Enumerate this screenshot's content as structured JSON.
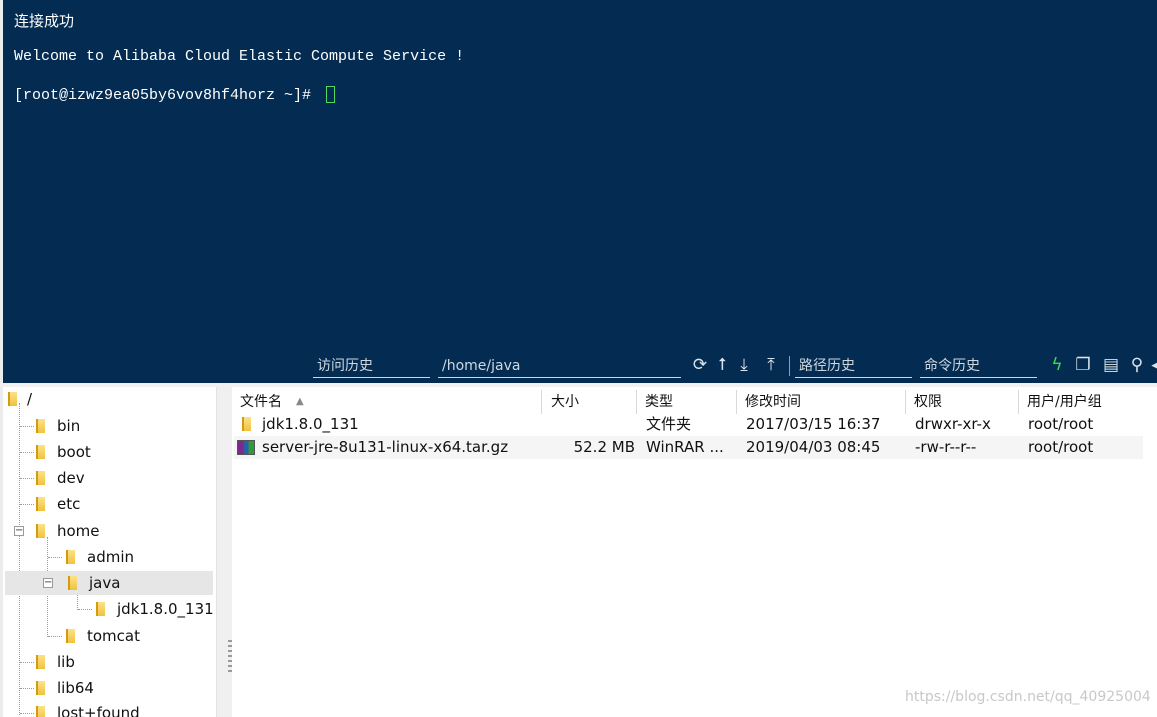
{
  "terminal": {
    "line1": "连接成功",
    "line2": "Welcome to Alibaba Cloud Elastic Compute Service !",
    "prompt": "[root@izwz9ea05by6vov8hf4horz ~]# "
  },
  "toolbar": {
    "history_label": "访问历史",
    "path_value": "/home/java",
    "path_history_label": "路径历史",
    "command_history_label": "命令历史"
  },
  "tree": {
    "root": "/",
    "items": [
      "bin",
      "boot",
      "dev",
      "etc",
      "home",
      "admin",
      "java",
      "jdk1.8.0_131",
      "tomcat",
      "lib",
      "lib64",
      "lost+found"
    ]
  },
  "files": {
    "columns": [
      "文件名",
      "大小",
      "类型",
      "修改时间",
      "权限",
      "用户/用户组"
    ],
    "rows": [
      {
        "name": "jdk1.8.0_131",
        "size": "",
        "type": "文件夹",
        "modified": "2017/03/15 16:37",
        "perms": "drwxr-xr-x",
        "owner": "root/root"
      },
      {
        "name": "server-jre-8u131-linux-x64.tar.gz",
        "size": "52.2 MB",
        "type": "WinRAR ...",
        "modified": "2019/04/03 08:45",
        "perms": "-rw-r--r--",
        "owner": "root/root"
      }
    ]
  },
  "watermark": "https://blog.csdn.net/qq_40925004",
  "colors": {
    "terminal_bg": "#042c52",
    "cursor": "#4cd964"
  }
}
